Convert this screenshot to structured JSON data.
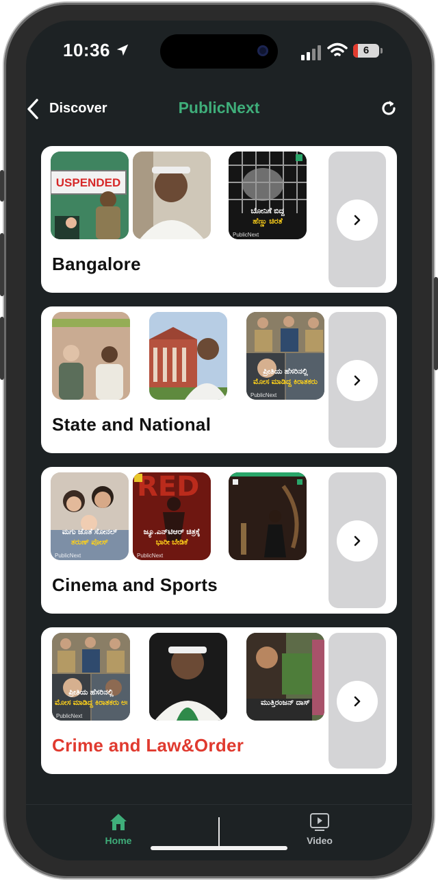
{
  "status": {
    "time": "10:36",
    "battery": "6"
  },
  "header": {
    "back_label": "Discover",
    "title": "PublicNext"
  },
  "cards": [
    {
      "title": "Bangalore",
      "thumbs": [
        {
          "banner": "USPENDED",
          "caption": "",
          "caption2": "",
          "brand": ""
        },
        {
          "banner": "",
          "caption": "",
          "caption2": "",
          "brand": ""
        },
        {
          "banner": "",
          "caption": "ಬೋನಿಗೆ ಬಿದ್ದ",
          "caption2": "ಹೆಣ್ಣು ಚಿರತೆ",
          "brand": "PublicNext"
        }
      ]
    },
    {
      "title": "State and National",
      "thumbs": [
        {
          "banner": "",
          "caption": "",
          "caption2": "",
          "brand": ""
        },
        {
          "banner": "",
          "caption": "",
          "caption2": "",
          "brand": ""
        },
        {
          "banner": "",
          "caption": "ಪ್ರೀತಿಯ ಹೆಸರಿನಲ್ಲಿ",
          "caption2": "ಮೋಸ ಮಾಡಿದ್ದ ಕಿರಾತಕರು",
          "brand": "PublicNext"
        }
      ]
    },
    {
      "title": "Cinema and Sports",
      "thumbs": [
        {
          "banner": "",
          "caption": "ಮಗು ಜೊತೆ ಸೋನಲ್",
          "caption2": "ತರುಣ್ ಪೋಸ್",
          "brand": "PublicNext"
        },
        {
          "banner": "",
          "caption": "ಜ್ಯೂ.ಎನ್‌ಟಿಆರ್ ಚಿತ್ರಕ್ಕೆ",
          "caption2": "ಭಾರೀ ಬೇಡಿಕೆ",
          "brand": "PublicNext"
        },
        {
          "banner": "",
          "caption": "",
          "caption2": "",
          "brand": ""
        }
      ]
    },
    {
      "title": "Crime and Law&Order",
      "thumbs": [
        {
          "banner": "",
          "caption": "ಪ್ರೀತಿಯ ಹೆಸರಿನಲ್ಲಿ",
          "caption2": "ಮೋಸ ಮಾಡಿದ್ದ ಕಿರಾತಕರು ಅರೆಸ್ಟ್",
          "brand": "PublicNext"
        },
        {
          "banner": "",
          "caption": "",
          "caption2": "",
          "brand": ""
        },
        {
          "banner": "",
          "caption": "ಮುತ್ತಿರಂಜನ್ ದಾಸ್",
          "caption2": "",
          "brand": ""
        }
      ]
    }
  ],
  "tabs": {
    "home": "Home",
    "video": "Video"
  },
  "colors": {
    "accent": "#3fae7a",
    "danger": "#e03a2f",
    "background": "#1d2224"
  }
}
